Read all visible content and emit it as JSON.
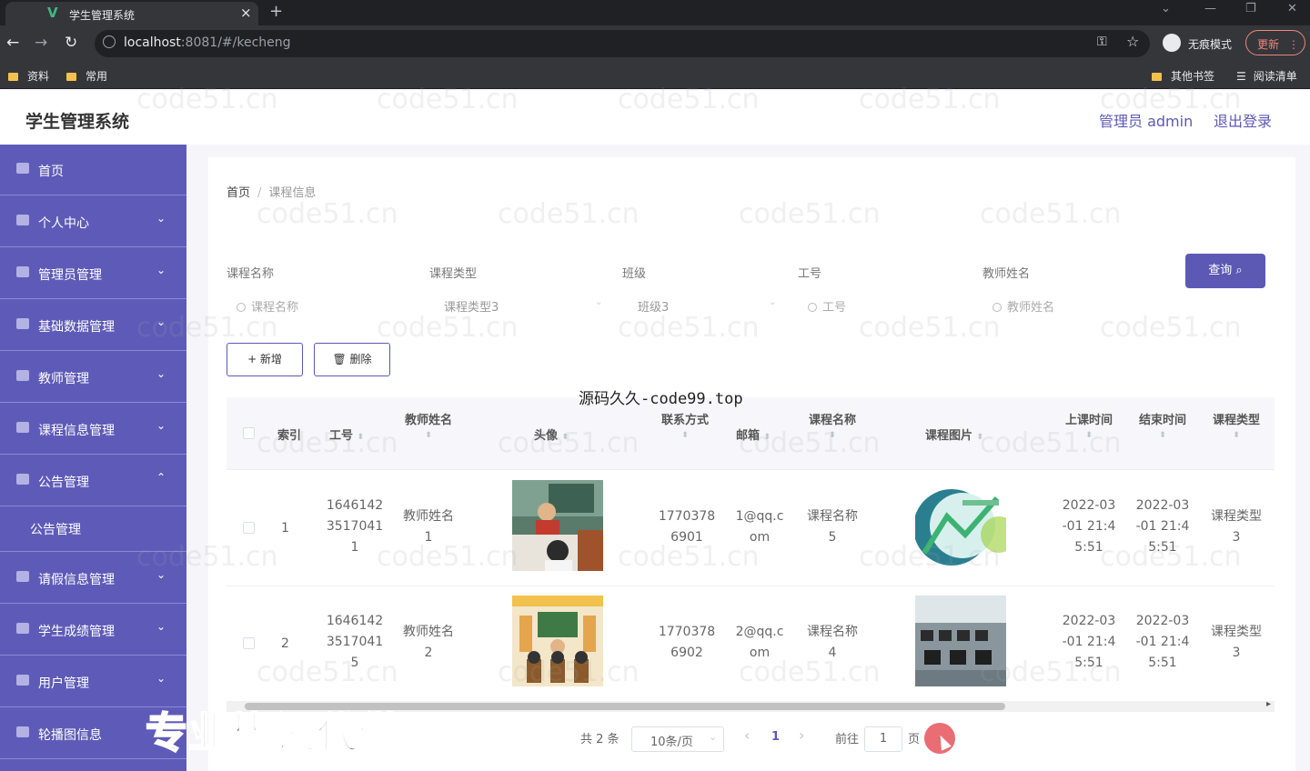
{
  "browser": {
    "tab_title": "学生管理系统",
    "tab_close": "×",
    "new_tab": "+",
    "url_host": "localhost",
    "url_rest": ":8081/#/kecheng",
    "incognito": "无痕模式",
    "update": "更新",
    "bookmarks": [
      "资料",
      "常用"
    ],
    "bookmarks_right": [
      "其他书签",
      "阅读清单"
    ]
  },
  "header": {
    "title": "学生管理系统",
    "admin": "管理员 admin",
    "logout": "退出登录"
  },
  "sidebar": {
    "items": [
      {
        "label": "首页",
        "chevron": ""
      },
      {
        "label": "个人中心",
        "chevron": "⌄"
      },
      {
        "label": "管理员管理",
        "chevron": "⌄"
      },
      {
        "label": "基础数据管理",
        "chevron": "⌄"
      },
      {
        "label": "教师管理",
        "chevron": "⌄"
      },
      {
        "label": "课程信息管理",
        "chevron": "⌄"
      },
      {
        "label": "公告管理",
        "chevron": "⌃"
      },
      {
        "label": "请假信息管理",
        "chevron": "⌄"
      },
      {
        "label": "学生成绩管理",
        "chevron": "⌄"
      },
      {
        "label": "用户管理",
        "chevron": "⌄"
      },
      {
        "label": "轮播图信息",
        "chevron": ""
      }
    ],
    "submenu": "公告管理"
  },
  "breadcrumb": {
    "home": "首页",
    "sep": "/",
    "current": "课程信息"
  },
  "filters": {
    "course_name_label": "课程名称",
    "course_name_placeholder": "课程名称",
    "course_type_label": "课程类型",
    "course_type_value": "课程类型3",
    "class_label": "班级",
    "class_value": "班级3",
    "job_no_label": "工号",
    "job_no_placeholder": "工号",
    "teacher_label": "教师姓名",
    "teacher_placeholder": "教师姓名",
    "query": "查询 ⌕"
  },
  "actions": {
    "add": "+ 新增",
    "delete": "🗑 删除"
  },
  "table": {
    "headers": {
      "index": "索引",
      "job_no": "工号",
      "teacher": "教师姓名",
      "avatar": "头像",
      "contact": "联系方式",
      "email": "邮箱",
      "course_name": "课程名称",
      "course_img": "课程图片",
      "start": "上课时间",
      "end": "结束时间",
      "type": "课程类型"
    },
    "rows": [
      {
        "index": "1",
        "job_no": [
          "1646142",
          "3517041",
          "1"
        ],
        "teacher": [
          "教师姓名",
          "1"
        ],
        "contact": [
          "1770378",
          "6901"
        ],
        "email": [
          "1@qq.c",
          "om"
        ],
        "course_name": [
          "课程名称",
          "5"
        ],
        "start": [
          "2022-03",
          "-01 21:4",
          "5:51"
        ],
        "end": [
          "2022-03",
          "-01 21:4",
          "5:51"
        ],
        "type": [
          "课程类型",
          "3"
        ]
      },
      {
        "index": "2",
        "job_no": [
          "1646142",
          "3517041",
          "5"
        ],
        "teacher": [
          "教师姓名",
          "2"
        ],
        "contact": [
          "1770378",
          "6902"
        ],
        "email": [
          "2@qq.c",
          "om"
        ],
        "course_name": [
          "课程名称",
          "4"
        ],
        "start": [
          "2022-03",
          "-01 21:4",
          "5:51"
        ],
        "end": [
          "2022-03",
          "-01 21:4",
          "5:51"
        ],
        "type": [
          "课程类型",
          "3"
        ]
      }
    ]
  },
  "pagination": {
    "total": "共 2 条",
    "page_size": "10条/页",
    "prev": "‹",
    "current": "1",
    "next": "›",
    "goto": "前往",
    "goto_value": "1",
    "page_suffix": "页"
  },
  "overlays": {
    "top_text": "源码久久-code99.top",
    "bottom_text": "专业毕设代做",
    "watermark": "code51.cn"
  },
  "colors": {
    "accent": "#5c59b5",
    "sidebar": "#5e5bb8"
  }
}
